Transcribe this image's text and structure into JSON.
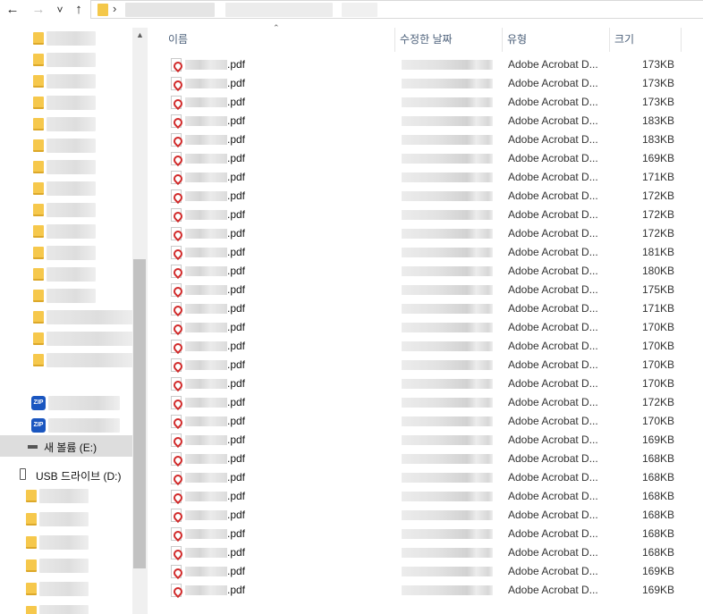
{
  "address_bar": {
    "back_icon": "arrow-left-icon",
    "forward_icon": "arrow-right-icon",
    "recent_icon": "chevron-down-icon",
    "up_icon": "arrow-up-icon",
    "breadcrumb_separator": "›",
    "back_glyph": "←",
    "forward_glyph": "→",
    "recent_glyph": "˅",
    "up_glyph": "↑"
  },
  "nav_pane": {
    "drive_e_label": "새 볼륨 (E:)",
    "drive_d_label": "USB 드라이브 (D:)",
    "zip_badge": "ZIP",
    "scroll_up_glyph": "▲"
  },
  "columns": {
    "name": "이름",
    "modified": "수정한 날짜",
    "type": "유형",
    "size": "크기",
    "sort_glyph": "⌃"
  },
  "files": [
    {
      "ext": ".pdf",
      "type": "Adobe Acrobat D...",
      "size": "173KB"
    },
    {
      "ext": ".pdf",
      "type": "Adobe Acrobat D...",
      "size": "173KB"
    },
    {
      "ext": ".pdf",
      "type": "Adobe Acrobat D...",
      "size": "173KB"
    },
    {
      "ext": ".pdf",
      "type": "Adobe Acrobat D...",
      "size": "183KB"
    },
    {
      "ext": ".pdf",
      "type": "Adobe Acrobat D...",
      "size": "183KB"
    },
    {
      "ext": ".pdf",
      "type": "Adobe Acrobat D...",
      "size": "169KB"
    },
    {
      "ext": ".pdf",
      "type": "Adobe Acrobat D...",
      "size": "171KB"
    },
    {
      "ext": ".pdf",
      "type": "Adobe Acrobat D...",
      "size": "172KB"
    },
    {
      "ext": ".pdf",
      "type": "Adobe Acrobat D...",
      "size": "172KB"
    },
    {
      "ext": ".pdf",
      "type": "Adobe Acrobat D...",
      "size": "172KB"
    },
    {
      "ext": ".pdf",
      "type": "Adobe Acrobat D...",
      "size": "181KB"
    },
    {
      "ext": ".pdf",
      "type": "Adobe Acrobat D...",
      "size": "180KB"
    },
    {
      "ext": ".pdf",
      "type": "Adobe Acrobat D...",
      "size": "175KB"
    },
    {
      "ext": ".pdf",
      "type": "Adobe Acrobat D...",
      "size": "171KB"
    },
    {
      "ext": ".pdf",
      "type": "Adobe Acrobat D...",
      "size": "170KB"
    },
    {
      "ext": ".pdf",
      "type": "Adobe Acrobat D...",
      "size": "170KB"
    },
    {
      "ext": ".pdf",
      "type": "Adobe Acrobat D...",
      "size": "170KB"
    },
    {
      "ext": ".pdf",
      "type": "Adobe Acrobat D...",
      "size": "170KB"
    },
    {
      "ext": ".pdf",
      "type": "Adobe Acrobat D...",
      "size": "172KB"
    },
    {
      "ext": ".pdf",
      "type": "Adobe Acrobat D...",
      "size": "170KB"
    },
    {
      "ext": ".pdf",
      "type": "Adobe Acrobat D...",
      "size": "169KB"
    },
    {
      "ext": ".pdf",
      "type": "Adobe Acrobat D...",
      "size": "168KB"
    },
    {
      "ext": ".pdf",
      "type": "Adobe Acrobat D...",
      "size": "168KB"
    },
    {
      "ext": ".pdf",
      "type": "Adobe Acrobat D...",
      "size": "168KB"
    },
    {
      "ext": ".pdf",
      "type": "Adobe Acrobat D...",
      "size": "168KB"
    },
    {
      "ext": ".pdf",
      "type": "Adobe Acrobat D...",
      "size": "168KB"
    },
    {
      "ext": ".pdf",
      "type": "Adobe Acrobat D...",
      "size": "168KB"
    },
    {
      "ext": ".pdf",
      "type": "Adobe Acrobat D...",
      "size": "169KB"
    },
    {
      "ext": ".pdf",
      "type": "Adobe Acrobat D...",
      "size": "169KB"
    }
  ]
}
